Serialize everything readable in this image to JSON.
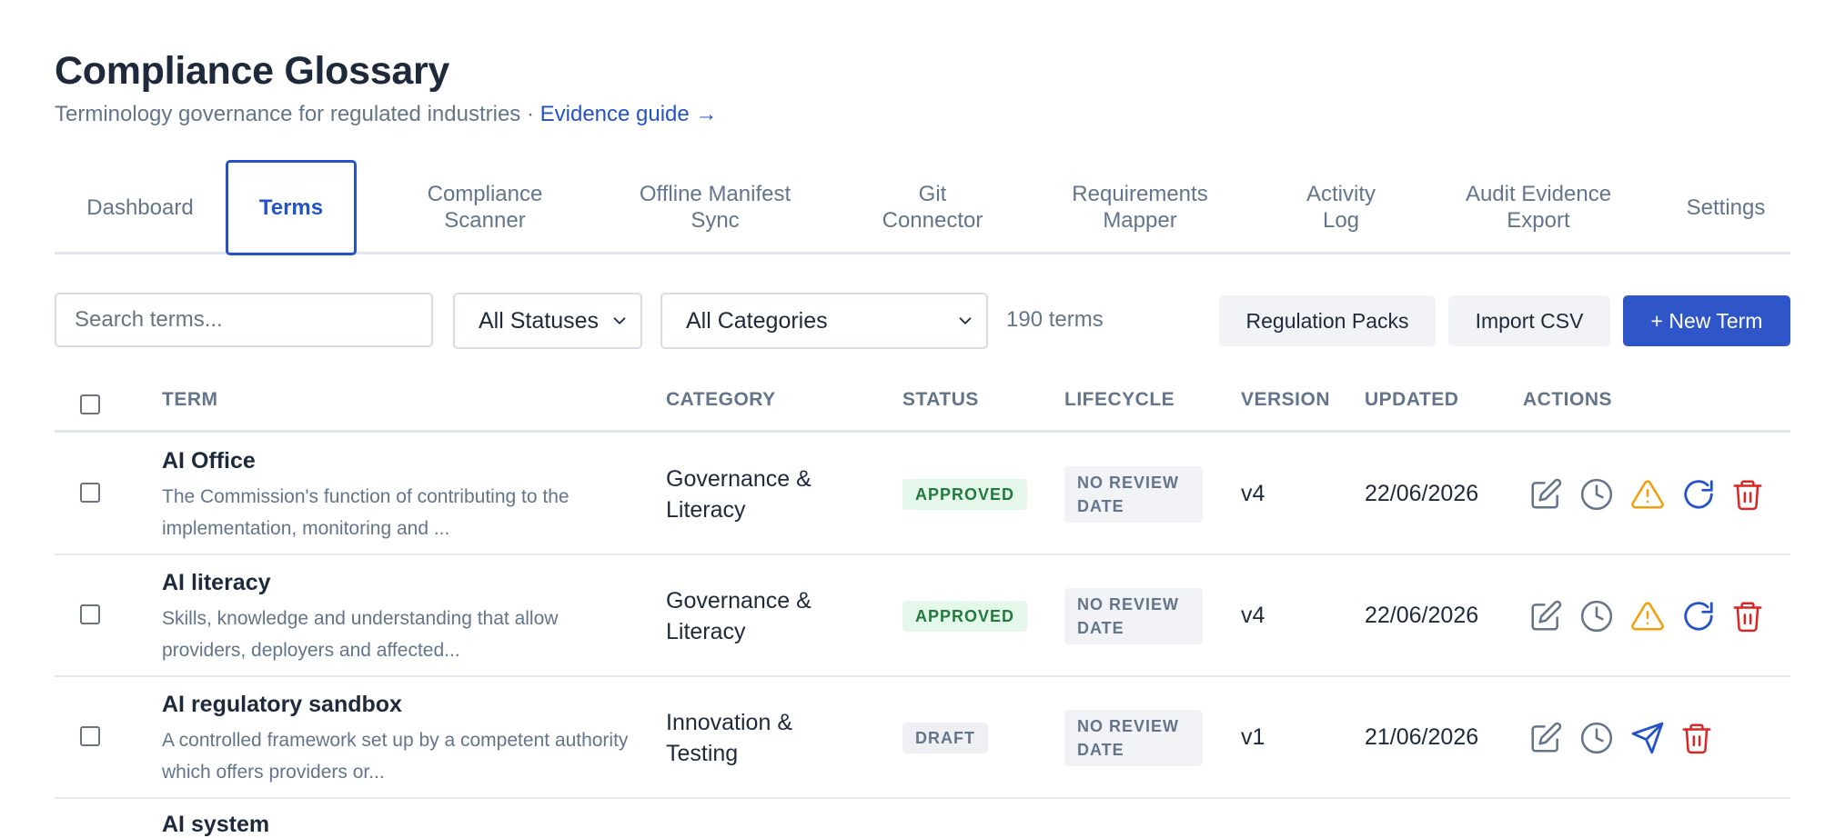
{
  "header": {
    "title": "Compliance Glossary",
    "subtitle": "Terminology governance for regulated industries · ",
    "guide_link": "Evidence guide →"
  },
  "tabs": [
    {
      "line1": "Dashboard",
      "line2": ""
    },
    {
      "line1": "Terms",
      "line2": ""
    },
    {
      "line1": "Compliance",
      "line2": "Scanner"
    },
    {
      "line1": "Offline Manifest",
      "line2": "Sync"
    },
    {
      "line1": "Git",
      "line2": "Connector"
    },
    {
      "line1": "Requirements",
      "line2": "Mapper"
    },
    {
      "line1": "Activity",
      "line2": "Log"
    },
    {
      "line1": "Audit Evidence",
      "line2": "Export"
    },
    {
      "line1": "Settings",
      "line2": ""
    }
  ],
  "active_tab": "Terms",
  "toolbar": {
    "search_placeholder": "Search terms...",
    "status_filter": "All Statuses",
    "category_filter": "All Categories",
    "count": "190 terms",
    "regulation_packs": "Regulation Packs",
    "import_csv": "Import CSV",
    "new_term": "+ New Term"
  },
  "table": {
    "headers": {
      "term": "TERM",
      "category": "CATEGORY",
      "status": "STATUS",
      "lifecycle": "LIFECYCLE",
      "version": "VERSION",
      "updated": "UPDATED",
      "actions": "ACTIONS"
    },
    "rows": [
      {
        "name": "AI Office",
        "description": "The Commission's function of contributing to the implementation, monitoring and ...",
        "category": "Governance & Literacy",
        "status": "APPROVED",
        "lifecycle": "NO REVIEW DATE",
        "version": "v4",
        "updated": "22/06/2026",
        "actions": [
          "edit-icon",
          "history-icon",
          "warning-icon",
          "refresh-icon",
          "trash-icon"
        ]
      },
      {
        "name": "AI literacy",
        "description": "Skills, knowledge and understanding that allow providers, deployers and affected...",
        "category": "Governance & Literacy",
        "status": "APPROVED",
        "lifecycle": "NO REVIEW DATE",
        "version": "v4",
        "updated": "22/06/2026",
        "actions": [
          "edit-icon",
          "history-icon",
          "warning-icon",
          "refresh-icon",
          "trash-icon"
        ]
      },
      {
        "name": "AI regulatory sandbox",
        "description": "A controlled framework set up by a competent authority which offers providers or...",
        "category": "Innovation & Testing",
        "status": "DRAFT",
        "lifecycle": "NO REVIEW DATE",
        "version": "v1",
        "updated": "21/06/2026",
        "actions": [
          "edit-icon",
          "history-icon",
          "send-icon",
          "trash-icon"
        ]
      }
    ],
    "partial_row_name": "AI system"
  },
  "colors": {
    "accent": "#2453c8",
    "approved_bg": "#e5f7ea",
    "approved_text": "#1f7a3d",
    "warning": "#f59e0b",
    "danger": "#dc2626",
    "muted": "#64748b"
  }
}
